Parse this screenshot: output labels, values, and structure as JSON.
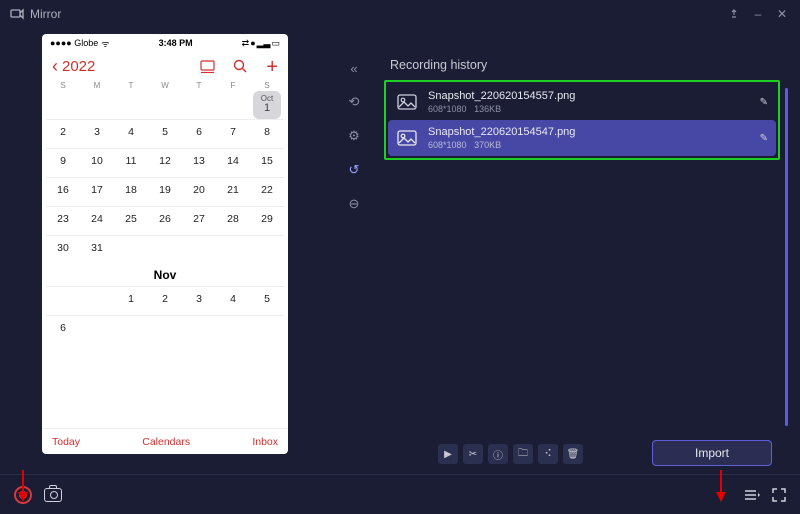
{
  "app": {
    "title": "Mirror"
  },
  "window": {
    "pin": "📌",
    "minimize": "–",
    "close": "✕"
  },
  "phone": {
    "carrier": "●●●● Globe",
    "wifi": "ᯤ",
    "time": "3:48 PM",
    "year": "2022",
    "days": [
      "S",
      "M",
      "T",
      "W",
      "T",
      "F",
      "S"
    ],
    "oct_label": "Oct",
    "oct_day": "1",
    "nov_label": "Nov",
    "oct_rows": [
      [
        "2",
        "3",
        "4",
        "5",
        "6",
        "7",
        "8"
      ],
      [
        "9",
        "10",
        "11",
        "12",
        "13",
        "14",
        "15"
      ],
      [
        "16",
        "17",
        "18",
        "19",
        "20",
        "21",
        "22"
      ],
      [
        "23",
        "24",
        "25",
        "26",
        "27",
        "28",
        "29"
      ],
      [
        "30",
        "31",
        "",
        "",
        "",
        "",
        ""
      ]
    ],
    "nov_rows": [
      [
        "",
        "",
        "1",
        "2",
        "3",
        "4",
        "5"
      ],
      [
        "6",
        "",
        "",
        "",
        "",
        "",
        ""
      ]
    ],
    "footer": {
      "today": "Today",
      "calendars": "Calendars",
      "inbox": "Inbox"
    }
  },
  "history": {
    "title": "Recording history",
    "items": [
      {
        "name": "Snapshot_220620154557.png",
        "res": "608*1080",
        "size": "136KB",
        "selected": false
      },
      {
        "name": "Snapshot_220620154547.png",
        "res": "608*1080",
        "size": "370KB",
        "selected": true
      }
    ],
    "import": "Import"
  }
}
